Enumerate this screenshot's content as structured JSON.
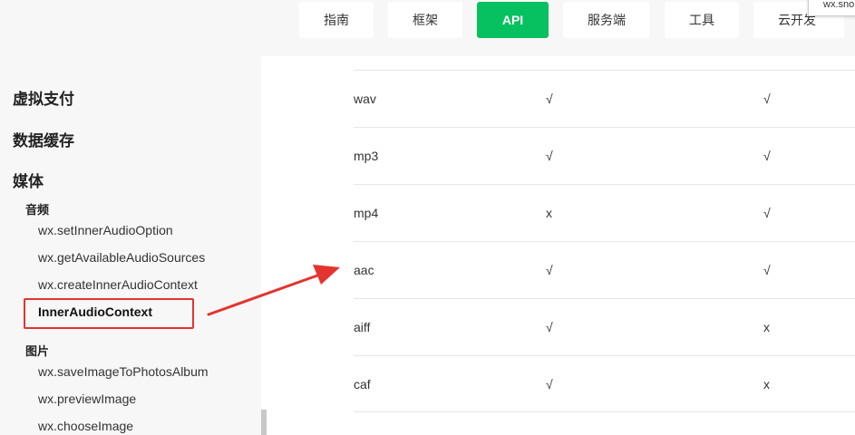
{
  "nav": {
    "items": [
      "指南",
      "框架",
      "API",
      "服务端",
      "工具",
      "云开发"
    ],
    "active": "API",
    "accent_color": "#07c160"
  },
  "tooltip": "wx.sno",
  "sidebar": {
    "categories": [
      "虚拟支付",
      "数据缓存",
      "媒体"
    ],
    "audio": {
      "title": "音频",
      "items": [
        "wx.setInnerAudioOption",
        "wx.getAvailableAudioSources",
        "wx.createInnerAudioContext",
        "InnerAudioContext"
      ]
    },
    "image": {
      "title": "图片",
      "items": [
        "wx.saveImageToPhotosAlbum",
        "wx.previewImage",
        "wx.chooseImage"
      ]
    }
  },
  "annotation": {
    "color": "#e3342f",
    "icon": "red-arrow-icon"
  },
  "table": {
    "rows": [
      [
        "wav",
        "√",
        "√"
      ],
      [
        "mp3",
        "√",
        "√"
      ],
      [
        "mp4",
        "x",
        "√"
      ],
      [
        "aac",
        "√",
        "√"
      ],
      [
        "aiff",
        "√",
        "x"
      ],
      [
        "caf",
        "√",
        "x"
      ]
    ]
  }
}
